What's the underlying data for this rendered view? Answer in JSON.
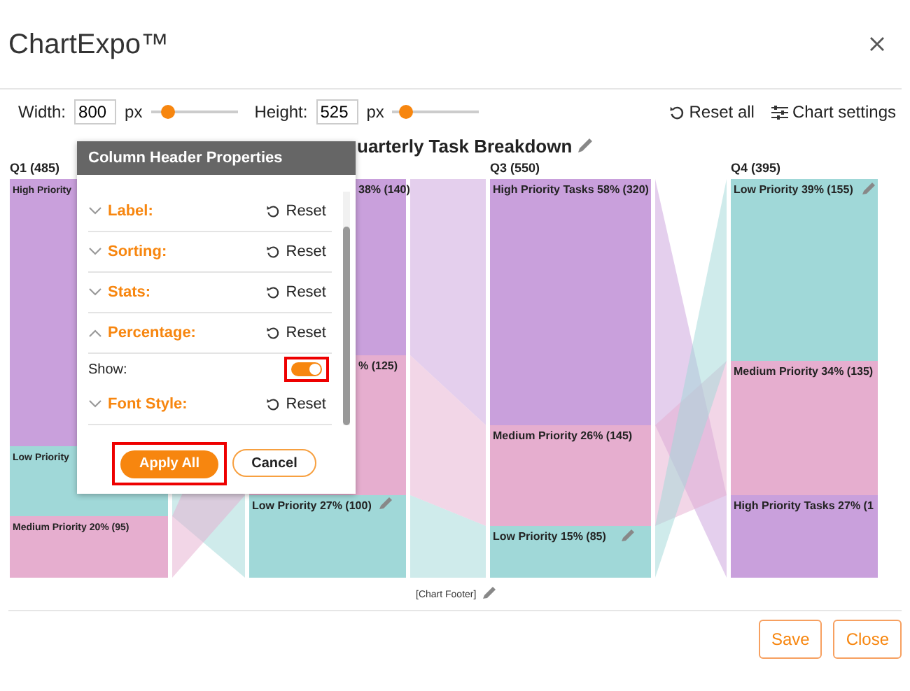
{
  "app": {
    "title": "ChartExpo™"
  },
  "toolbar": {
    "width_label": "Width:",
    "width_value": "800",
    "width_unit": "px",
    "width_slider": {
      "level": 0.2
    },
    "height_label": "Height:",
    "height_value": "525",
    "height_unit": "px",
    "height_slider": {
      "level": 0.15
    },
    "reset_all": "Reset all",
    "chart_settings": "Chart settings"
  },
  "chart": {
    "title": "uarterly Task Breakdown",
    "footer": "[Chart Footer]",
    "columns": [
      {
        "header": "Q1 (485)",
        "nodes": [
          {
            "label": "High Priority",
            "color": "#c9a0dc"
          },
          {
            "label": "Low Priority",
            "color": "#a0d8d8"
          },
          {
            "label": "Medium Priority 20% (95)",
            "color": "#e6aecf"
          }
        ]
      },
      {
        "nodes": [
          {
            "label": "38% (140)",
            "color": "#c9a0dc"
          },
          {
            "label": "% (125)",
            "color": "#e6aecf"
          },
          {
            "label": "Low Priority 27% (100)",
            "color": "#a0d8d8"
          }
        ]
      },
      {
        "header": "Q3 (550)",
        "nodes": [
          {
            "label": "High Priority Tasks 58% (320)",
            "color": "#c9a0dc"
          },
          {
            "label": "Medium Priority 26% (145)",
            "color": "#e6aecf"
          },
          {
            "label": "Low Priority 15% (85)",
            "color": "#a0d8d8"
          }
        ]
      },
      {
        "header": "Q4 (395)",
        "nodes": [
          {
            "label": "Low Priority 39% (155)",
            "color": "#a0d8d8"
          },
          {
            "label": "Medium Priority 34% (135)",
            "color": "#e6aecf"
          },
          {
            "label": "High Priority Tasks 27% (1",
            "color": "#c9a0dc"
          }
        ]
      }
    ]
  },
  "dialog": {
    "title": "Column Header Properties",
    "sections": [
      {
        "label": "Label:",
        "expanded": false,
        "reset": "Reset"
      },
      {
        "label": "Sorting:",
        "expanded": false,
        "reset": "Reset"
      },
      {
        "label": "Stats:",
        "expanded": false,
        "reset": "Reset"
      },
      {
        "label": "Percentage:",
        "expanded": true,
        "reset": "Reset",
        "options": [
          {
            "label": "Show:",
            "on": true
          }
        ]
      },
      {
        "label": "Font Style:",
        "expanded": false,
        "reset": "Reset"
      }
    ],
    "apply": "Apply All",
    "cancel": "Cancel"
  },
  "footer_buttons": [
    "Save",
    "Close"
  ]
}
